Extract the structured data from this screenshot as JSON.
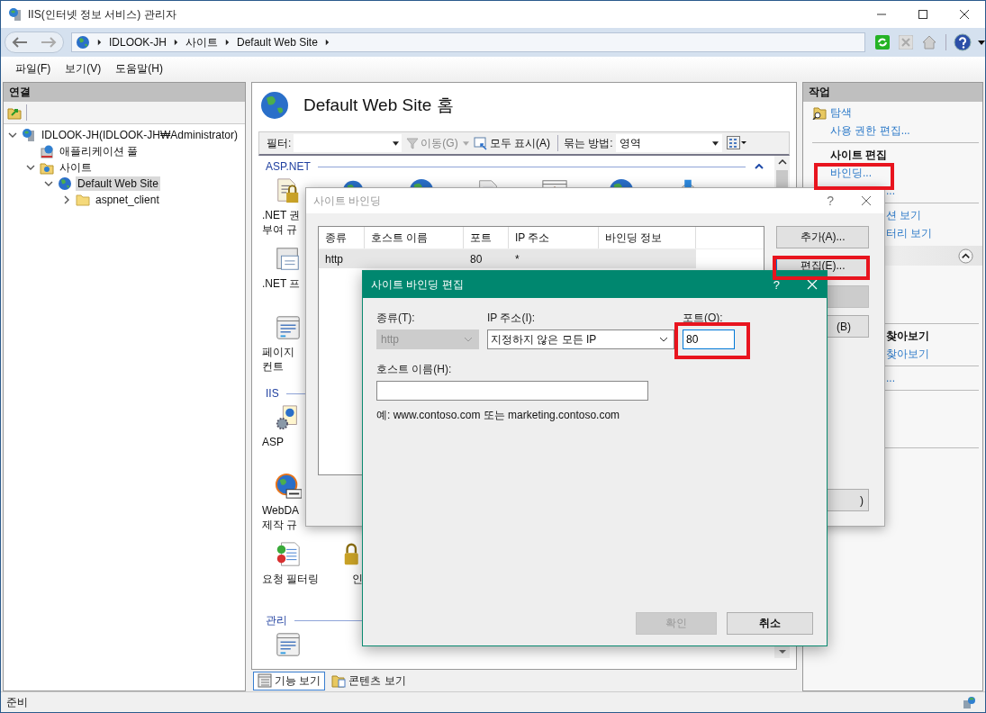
{
  "window": {
    "title": "IIS(인터넷 정보 서비스) 관리자"
  },
  "address_bar": {
    "path": [
      "IDLOOK-JH",
      "사이트",
      "Default Web Site"
    ]
  },
  "menu": [
    "파일(F)",
    "보기(V)",
    "도움말(H)"
  ],
  "connections": {
    "title": "연결",
    "tree": [
      {
        "label": "IDLOOK-JH(IDLOOK-JH₩Administrator)",
        "kind": "server",
        "expanded": true,
        "selected": false,
        "children": [
          {
            "label": "애플리케이션 풀",
            "kind": "pool",
            "selected": false
          },
          {
            "label": "사이트",
            "kind": "sites",
            "expanded": true,
            "selected": false,
            "children": [
              {
                "label": "Default Web Site",
                "kind": "site",
                "expanded": true,
                "selected": true,
                "children": [
                  {
                    "label": "aspnet_client",
                    "kind": "folder",
                    "expanded": false,
                    "selected": false
                  }
                ]
              }
            ]
          }
        ]
      }
    ]
  },
  "center": {
    "title": "Default Web Site 홈",
    "filter": {
      "label": "필터:",
      "go": "이동(G)",
      "show_all": "모두 표시(A)",
      "group_by_label": "묶는 방법:",
      "group_by": "영역"
    },
    "groups": [
      {
        "name": "ASP.NET",
        "expanded": true,
        "rows": [
          [
            {
              "kind": "lock-doc",
              "label": ".NET 권\n부여 규"
            },
            {
              "kind": "globe-user"
            },
            {
              "kind": "globe"
            },
            {
              "kind": "doc"
            },
            {
              "kind": "warning"
            },
            {
              "kind": "globe"
            },
            {
              "kind": "arrow"
            }
          ],
          [
            {
              "kind": "window",
              "label": ".NET 프"
            }
          ],
          [
            {
              "kind": "form",
              "label": "페이지\n컨트"
            }
          ]
        ]
      },
      {
        "name": "IIS",
        "rows": [
          [
            {
              "kind": "gear-doc",
              "label": "ASP"
            }
          ],
          [
            {
              "kind": "globe-dav",
              "label": "WebDA\n제작 규"
            }
          ],
          [
            {
              "kind": "filter-doc",
              "label": "요청 필터링"
            },
            {
              "kind": "lock",
              "label": "인"
            }
          ]
        ]
      },
      {
        "name": "관리",
        "rows": [
          [
            {
              "kind": "form"
            }
          ]
        ]
      }
    ],
    "views": [
      {
        "label": "기능 보기",
        "selected": true
      },
      {
        "label": "콘텐츠 보기",
        "selected": false
      }
    ]
  },
  "actions": {
    "title": "작업",
    "items": [
      {
        "kind": "icon-link",
        "label": "탐색"
      },
      {
        "kind": "link",
        "label": "사용 권한 편집..."
      },
      {
        "kind": "divider"
      },
      {
        "kind": "heading",
        "label": "사이트 편집"
      },
      {
        "kind": "link",
        "label": "바인딩..."
      },
      {
        "kind": "link",
        "label": "...",
        "offset": true
      },
      {
        "kind": "divider"
      },
      {
        "kind": "link",
        "label": "션 보기",
        "offset": true
      },
      {
        "kind": "link",
        "label": "터리 보기",
        "offset": true
      },
      {
        "kind": "bar",
        "expanded": true
      },
      {
        "kind": "divider"
      },
      {
        "kind": "heading",
        "label": "찾아보기",
        "offset": true
      },
      {
        "kind": "link",
        "label": "찾아보기",
        "offset": true
      },
      {
        "kind": "divider"
      },
      {
        "kind": "link",
        "label": "...",
        "offset": true
      },
      {
        "kind": "divider"
      },
      {
        "kind": "divider"
      }
    ]
  },
  "site_bindings": {
    "title": "사이트 바인딩",
    "help": "?",
    "columns": [
      "종류",
      "호스트 이름",
      "포트",
      "IP 주소",
      "바인딩 정보"
    ],
    "rows": [
      {
        "cells": [
          "http",
          null,
          "80",
          "*",
          null
        ],
        "selected": true
      }
    ],
    "buttons": [
      {
        "label": "추가(A)...",
        "disabled": false
      },
      {
        "label": "편집(E)...",
        "disabled": false
      },
      {
        "disabled": true
      },
      {
        "label": "(B)",
        "disabled": false
      },
      {
        "label": ")",
        "disabled": false
      }
    ]
  },
  "edit_binding": {
    "title": "사이트 바인딩 편집",
    "help": "?",
    "type": {
      "label": "종류(T):",
      "value": "http",
      "disabled": true
    },
    "ip": {
      "label": "IP 주소(I):",
      "value": "지정하지 않은 모든 IP"
    },
    "port": {
      "label": "포트(O):",
      "value": "80"
    },
    "host": {
      "label": "호스트 이름(H):"
    },
    "hint": "예: www.contoso.com 또는 marketing.contoso.com",
    "buttons": [
      {
        "label": "확인",
        "disabled": true
      },
      {
        "label": "취소",
        "disabled": false
      }
    ]
  },
  "status_bar": {
    "text": "준비"
  }
}
